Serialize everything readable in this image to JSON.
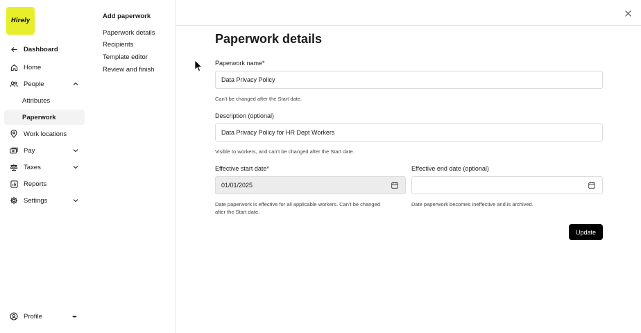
{
  "brand": {
    "logo_text": "Hirely",
    "accent": "#e7ef2a"
  },
  "nav": {
    "back": {
      "label": "Dashboard",
      "icon": "arrow-left-icon"
    },
    "items": [
      {
        "label": "Home",
        "icon": "home-icon"
      },
      {
        "label": "People",
        "icon": "people-icon",
        "expanded": true
      },
      {
        "label": "Attributes"
      },
      {
        "label": "Paperwork",
        "active": true
      },
      {
        "label": "Work locations",
        "icon": "map-pin-icon"
      },
      {
        "label": "Pay",
        "icon": "pay-icon"
      },
      {
        "label": "Taxes",
        "icon": "scales-icon"
      },
      {
        "label": "Reports",
        "icon": "reports-icon"
      },
      {
        "label": "Settings",
        "icon": "gear-icon"
      }
    ],
    "profile": {
      "label": "Profile",
      "icon": "user-circle-icon",
      "more": "•••"
    }
  },
  "steps": {
    "title": "Add paperwork",
    "items": [
      "Paperwork details",
      "Recipients",
      "Template editor",
      "Review and finish"
    ]
  },
  "form": {
    "heading": "Paperwork details",
    "name": {
      "label": "Paperwork name*",
      "value": "Data Privacy Policy",
      "help": "Can’t be changed after the Start date."
    },
    "description": {
      "label": "Description (optional)",
      "value": "Data Privacy Policy for HR Dept Workers",
      "help": "Visible to workers, and can’t be changed after the Start date."
    },
    "start_date": {
      "label": "Effective start date*",
      "value": "01/01/2025",
      "help_line1": "Date paperwork is effective for all applicable workers. Can’t be changed",
      "help_line2": "after the Start date."
    },
    "end_date": {
      "label": "Effective end date (optional)",
      "value": "",
      "help": "Date paperwork becomes ineffective and is archived."
    },
    "submit_label": "Update"
  }
}
